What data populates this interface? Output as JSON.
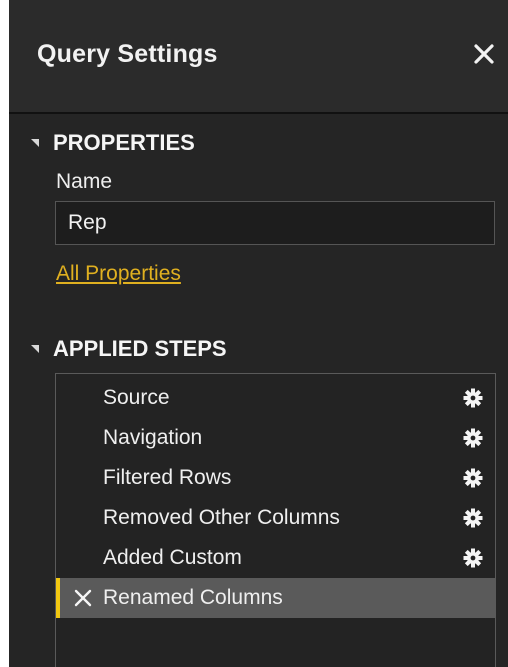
{
  "panel": {
    "title": "Query Settings"
  },
  "properties": {
    "heading": "PROPERTIES",
    "name_label": "Name",
    "name_value": "Rep",
    "all_properties_link": "All Properties"
  },
  "applied_steps": {
    "heading": "APPLIED STEPS",
    "steps": [
      {
        "label": "Source",
        "icon": "gear-icon"
      },
      {
        "label": "Navigation",
        "icon": "gear-icon"
      },
      {
        "label": "Filtered Rows",
        "icon": "gear-icon"
      },
      {
        "label": "Removed Other Columns",
        "icon": "gear-icon"
      },
      {
        "label": "Added Custom",
        "icon": "gear-icon"
      },
      {
        "label": "Renamed Columns",
        "icon": "delete-step-icon",
        "selected": true
      }
    ]
  },
  "colors": {
    "panel_bg": "#252525",
    "accent_link": "#e0b020",
    "selection_bar": "#f2c811",
    "selection_bg": "#5a5a5a"
  }
}
